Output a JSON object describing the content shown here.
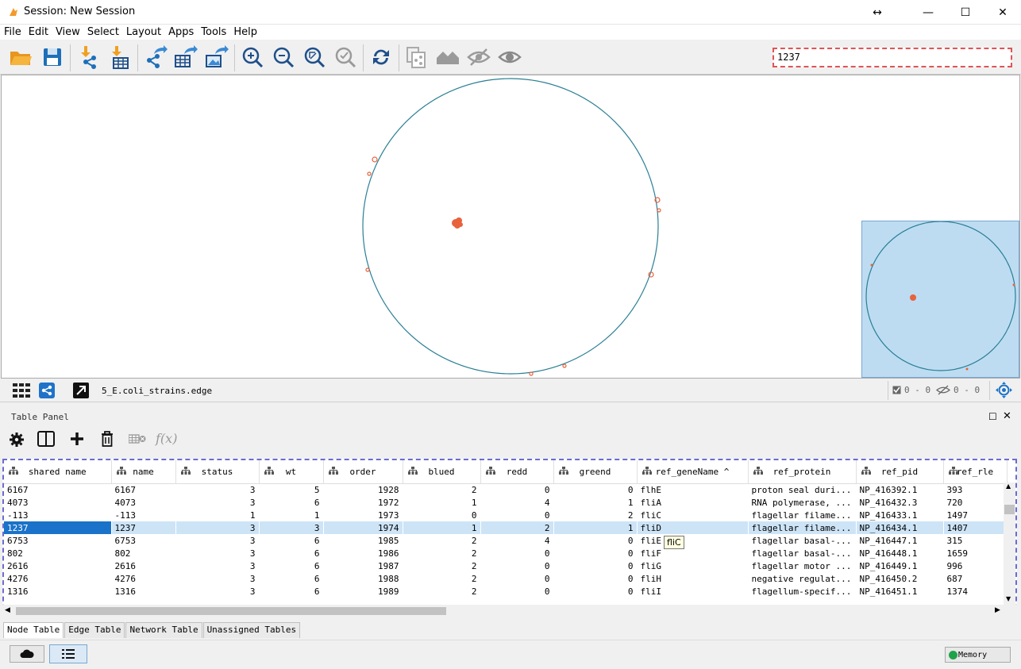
{
  "window": {
    "title": "Session: New Session"
  },
  "menu": [
    "File",
    "Edit",
    "View",
    "Select",
    "Layout",
    "Apps",
    "Tools",
    "Help"
  ],
  "toolbar": {
    "icons": [
      "open-session-icon",
      "save-session-icon",
      "import-network-icon",
      "import-table-icon",
      "export-network-icon",
      "export-table-icon",
      "export-image-icon",
      "zoom-in-icon",
      "zoom-out-icon",
      "zoom-fit-icon",
      "zoom-selected-icon",
      "refresh-icon",
      "copy-network-icon",
      "home-icon",
      "hide-icon",
      "show-icon"
    ],
    "search_value": "1237"
  },
  "network": {
    "name": "5_E.coli_strains.edge",
    "selected_nodes": "0 - 0",
    "hidden": "0 - 0",
    "node_color": "#e8623c",
    "edge_color": "#2a7f95"
  },
  "table_panel": {
    "title": "Table Panel",
    "columns": [
      "shared name",
      "name",
      "status",
      "wt",
      "order",
      "blued",
      "redd",
      "greend",
      "ref_geneName",
      "ref_protein",
      "ref_pid",
      "ref_rle"
    ],
    "rows": [
      [
        "6167",
        "6167",
        "3",
        "5",
        "1928",
        "2",
        "0",
        "0",
        "flhE",
        "proton seal duri...",
        "NP_416392.1",
        "393"
      ],
      [
        "4073",
        "4073",
        "3",
        "6",
        "1972",
        "1",
        "4",
        "1",
        "fliA",
        "RNA polymerase, ...",
        "NP_416432.3",
        "720"
      ],
      [
        "-113",
        "-113",
        "1",
        "1",
        "1973",
        "0",
        "0",
        "2",
        "fliC",
        "flagellar filame...",
        "NP_416433.1",
        "1497"
      ],
      [
        "1237",
        "1237",
        "3",
        "3",
        "1974",
        "1",
        "2",
        "1",
        "fliD",
        "flagellar filame...",
        "NP_416434.1",
        "1407"
      ],
      [
        "6753",
        "6753",
        "3",
        "6",
        "1985",
        "2",
        "4",
        "0",
        "fliE",
        "flagellar basal-...",
        "NP_416447.1",
        "315"
      ],
      [
        "802",
        "802",
        "3",
        "6",
        "1986",
        "2",
        "0",
        "0",
        "fliF",
        "flagellar basal-...",
        "NP_416448.1",
        "1659"
      ],
      [
        "2616",
        "2616",
        "3",
        "6",
        "1987",
        "2",
        "0",
        "0",
        "fliG",
        "flagellar motor ...",
        "NP_416449.1",
        "996"
      ],
      [
        "4276",
        "4276",
        "3",
        "6",
        "1988",
        "2",
        "0",
        "0",
        "fliH",
        "negative regulat...",
        "NP_416450.2",
        "687"
      ],
      [
        "1316",
        "1316",
        "3",
        "6",
        "1989",
        "2",
        "0",
        "0",
        "fliI",
        "flagellum-specif...",
        "NP_416451.1",
        "1374"
      ]
    ],
    "tooltip": "fliC",
    "tabs": [
      "Node Table",
      "Edge Table",
      "Network Table",
      "Unassigned Tables"
    ]
  },
  "status": {
    "memory_label": "Memory"
  }
}
